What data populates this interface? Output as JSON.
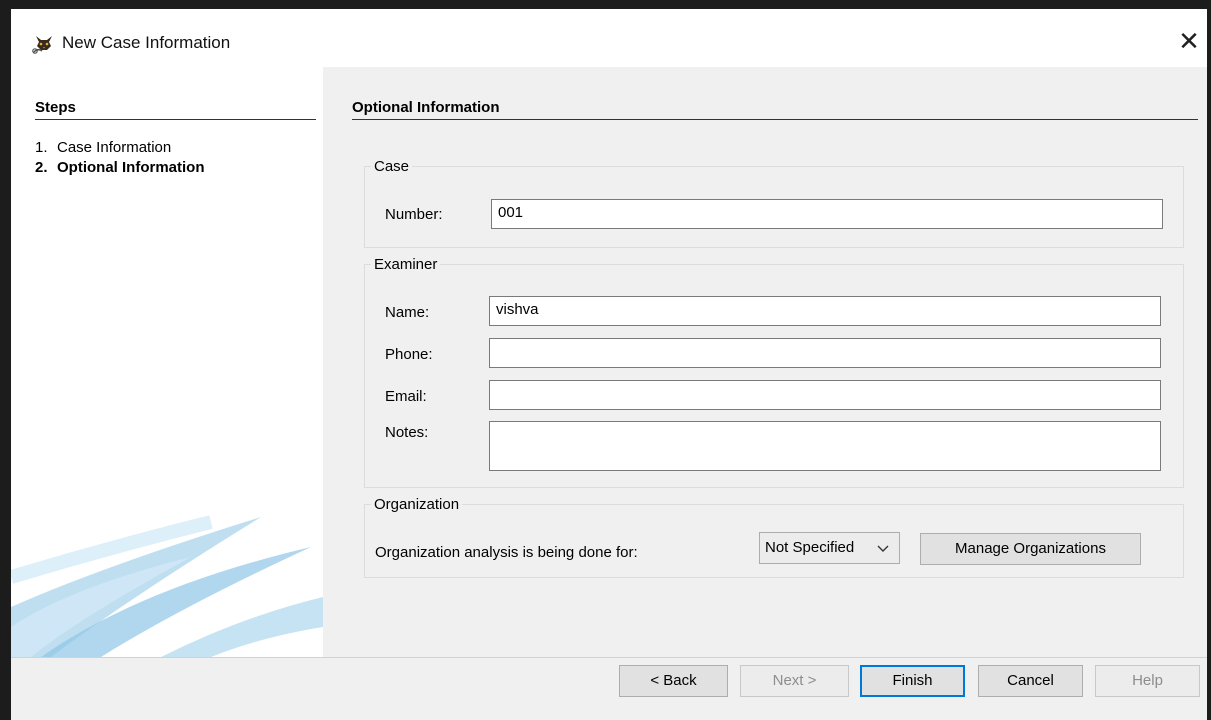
{
  "window": {
    "title": "New Case Information",
    "close_glyph": "✕"
  },
  "steps": {
    "heading": "Steps",
    "items": [
      {
        "number": "1.",
        "label": "Case Information"
      },
      {
        "number": "2.",
        "label": "Optional Information"
      }
    ]
  },
  "panel": {
    "heading": "Optional Information"
  },
  "case_group": {
    "title": "Case",
    "number_label": "Number:",
    "number_value": "001"
  },
  "examiner_group": {
    "title": "Examiner",
    "name_label": "Name:",
    "name_value": "vishva",
    "phone_label": "Phone:",
    "phone_value": "",
    "email_label": "Email:",
    "email_value": "",
    "notes_label": "Notes:",
    "notes_value": ""
  },
  "organization_group": {
    "title": "Organization",
    "prompt": "Organization analysis is being done for:",
    "selected": "Not Specified",
    "manage_button": "Manage Organizations"
  },
  "footer": {
    "back": "< Back",
    "next": "Next >",
    "finish": "Finish",
    "cancel": "Cancel",
    "help": "Help"
  },
  "icons": {
    "app": "autopsy-dog-icon",
    "close": "close-icon",
    "dropdown": "chevron-down-icon"
  },
  "colors": {
    "panel_bg": "#f0f0f0",
    "accent_border": "#0078d7",
    "swoosh": "#5aa9d8"
  }
}
